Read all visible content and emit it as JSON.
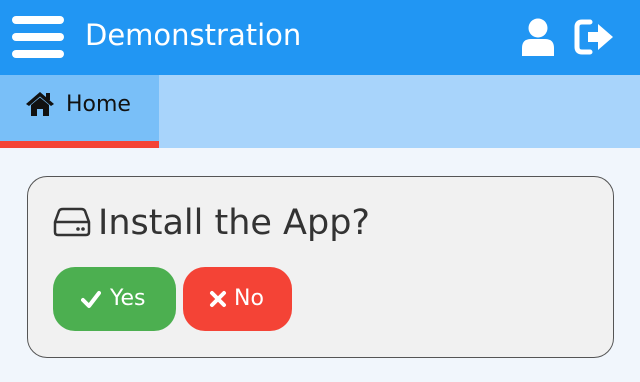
{
  "header": {
    "title": "Demonstration",
    "menu_icon": "hamburger-menu-icon",
    "user_icon": "user-icon",
    "logout_icon": "sign-out-icon",
    "background_color": "#2196f3"
  },
  "tabs": [
    {
      "label": "Home",
      "icon": "home-icon",
      "active": true,
      "active_indicator_color": "#f44336"
    }
  ],
  "dialog": {
    "title": "Install the App?",
    "icon": "hard-drive-icon",
    "buttons": {
      "yes": {
        "label": "Yes",
        "icon": "check-icon",
        "color": "#4caf50"
      },
      "no": {
        "label": "No",
        "icon": "close-icon",
        "color": "#f44336"
      }
    }
  }
}
